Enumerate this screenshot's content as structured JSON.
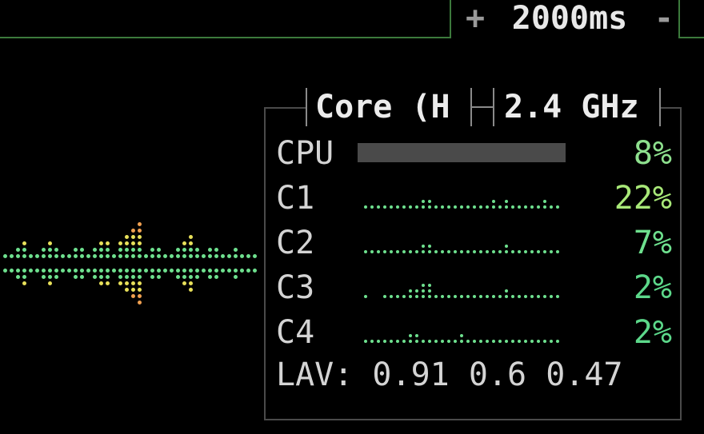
{
  "timer": {
    "plus": "+",
    "interval": "2000ms",
    "minus": "-"
  },
  "cpu_box": {
    "title_name": "Core (H",
    "title_freq": "2.4 GHz",
    "rows": [
      {
        "label": "CPU",
        "percent": "8%",
        "color": "#8ee08e"
      },
      {
        "label": "C1",
        "percent": "22%",
        "color": "#a8e878"
      },
      {
        "label": "C2",
        "percent": "7%",
        "color": "#6ee08e"
      },
      {
        "label": "C3",
        "percent": "2%",
        "color": "#5cd88a"
      },
      {
        "label": "C4",
        "percent": "2%",
        "color": "#5cd88a"
      }
    ],
    "load_avg": {
      "label": "LAV:",
      "values": [
        "0.91",
        "0.6",
        "0.47"
      ]
    }
  },
  "colors": {
    "border_green": "#3c7a3c",
    "box_border": "#4a4a4a",
    "dot_green": "#6ee08e",
    "dot_yellow": "#e8e05a",
    "dot_orange": "#f0a050"
  }
}
